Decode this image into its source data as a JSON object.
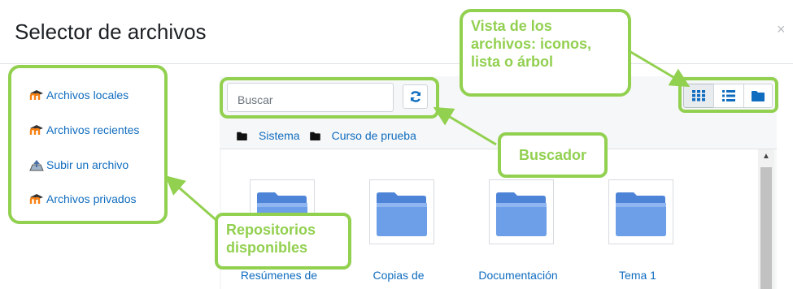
{
  "dialog": {
    "title": "Selector de archivos",
    "close_symbol": "×"
  },
  "repositories": [
    {
      "label": "Archivos locales",
      "icon": "moodle-icon"
    },
    {
      "label": "Archivos recientes",
      "icon": "moodle-icon"
    },
    {
      "label": "Subir un archivo",
      "icon": "upload-icon"
    },
    {
      "label": "Archivos privados",
      "icon": "moodle-icon"
    }
  ],
  "search": {
    "placeholder": "Buscar"
  },
  "breadcrumb": [
    "Sistema",
    "Curso de prueba"
  ],
  "view_buttons": [
    "icons-view",
    "list-view",
    "tree-view"
  ],
  "files": [
    {
      "name": "Resúmenes de"
    },
    {
      "name": "Copias de"
    },
    {
      "name": "Documentación"
    },
    {
      "name": "Tema 1"
    }
  ],
  "annotations": {
    "views": "Vista de los archivos: iconos, lista o árbol",
    "search": "Buscador",
    "repos": "Repositorios disponibles"
  },
  "colors": {
    "accent_green": "#92d050",
    "link_blue": "#0f6cbf",
    "folder_blue": "#6d9ee8"
  }
}
